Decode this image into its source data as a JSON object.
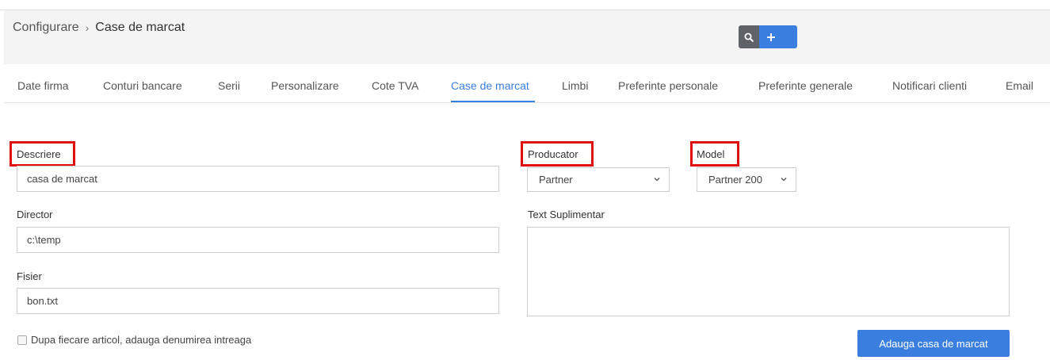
{
  "breadcrumb": {
    "parent": "Configurare",
    "separator": "›",
    "current": "Case de marcat"
  },
  "toolbar": {
    "search_icon": "search-icon",
    "add_icon": "plus-icon"
  },
  "tabs": [
    {
      "label": "Date firma",
      "active": false
    },
    {
      "label": "Conturi bancare",
      "active": false
    },
    {
      "label": "Serii",
      "active": false
    },
    {
      "label": "Personalizare",
      "active": false
    },
    {
      "label": "Cote TVA",
      "active": false
    },
    {
      "label": "Case de marcat",
      "active": true
    },
    {
      "label": "Limbi",
      "active": false
    },
    {
      "label": "Preferinte personale",
      "active": false
    },
    {
      "label": "Preferinte generale",
      "active": false
    },
    {
      "label": "Notificari clienti",
      "active": false
    },
    {
      "label": "Email",
      "active": false
    }
  ],
  "form": {
    "descriere": {
      "label": "Descriere",
      "value": "casa de marcat"
    },
    "director": {
      "label": "Director",
      "value": "c:\\temp"
    },
    "fisier": {
      "label": "Fisier",
      "value": "bon.txt"
    },
    "producator": {
      "label": "Producator",
      "selected": "Partner"
    },
    "model": {
      "label": "Model",
      "selected": "Partner 200"
    },
    "text_suplimentar": {
      "label": "Text Suplimentar",
      "value": ""
    },
    "checkbox": {
      "label": "Dupa fiecare articol, adauga denumirea intreaga",
      "checked": false
    },
    "submit_label": "Adauga casa de marcat"
  },
  "colors": {
    "accent": "#3a7fdf",
    "highlight_box": "#e01010",
    "search_button": "#5f6368"
  }
}
